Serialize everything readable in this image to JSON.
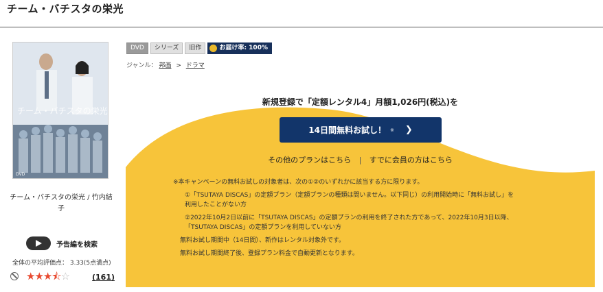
{
  "page": {
    "title": "チーム・バチスタの栄光"
  },
  "left": {
    "caption": "チーム・バチスタの栄光 / 竹内結子",
    "trailer_label": "予告編を検索",
    "avg_rating": "全体の平均評価点： 3.33(5点満点)",
    "rating_value": 3.33,
    "rating_max": 5,
    "review_count": "(161)"
  },
  "tags": [
    "DVD",
    "シリーズ",
    "旧作"
  ],
  "delivery_badge": "お届け率: 100%",
  "genre": {
    "label": "ジャンル：",
    "crumb1": "邦画",
    "sep": ">",
    "crumb2": "ドラマ"
  },
  "campaign": {
    "headline": "新規登録で「定額レンタル4」月額1,026円(税込)を",
    "trial_button": "14日間無料お試し！",
    "trial_mark": "※",
    "link_plans": "その他のプランはこちら",
    "link_divider": "|",
    "link_members": "すでに会員の方はこちら",
    "notes": [
      "※本キャンペーンの無料お試しの対象者は、次の①②のいずれかに該当する方に限ります。",
      "①「TSUTAYA DISCAS」の定額プラン（定額プランの種類は問いません。以下同じ）の利用開始時に「無料お試し」を",
      "利用したことがない方",
      "②2022年10月2日以前に「TSUTAYA DISCAS」の定額プランの利用を終了された方であって、2022年10月3日以降、",
      "「TSUTAYA DISCAS」の定額プランを利用していない方",
      "無料お試し期間中（14日間）、新作はレンタル対象外です。",
      "無料お試し期間終了後、登録プラン料金で自動更新となります。"
    ]
  },
  "colors": {
    "accent_navy": "#12356a",
    "campaign_yellow": "#f7c43a",
    "star_red": "#e8492f"
  }
}
